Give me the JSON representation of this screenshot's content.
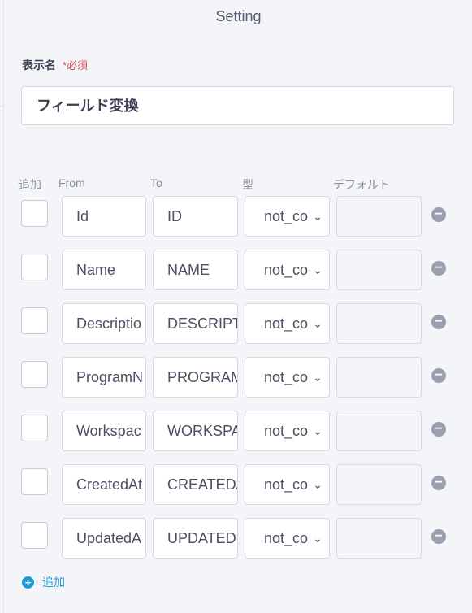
{
  "header": {
    "title": "Setting"
  },
  "display_name": {
    "label": "表示名",
    "required": "*必須",
    "value": "フィールド変換"
  },
  "table": {
    "headers": {
      "add": "追加",
      "from": "From",
      "to": "To",
      "type": "型",
      "default": "デフォルト"
    },
    "rows": [
      {
        "from": "Id",
        "to": "ID",
        "type": "not_co"
      },
      {
        "from": "Name",
        "to": "NAME",
        "type": "not_co"
      },
      {
        "from": "Descriptio",
        "to": "DESCRIPT",
        "type": "not_co"
      },
      {
        "from": "ProgramN",
        "to": "PROGRAM",
        "type": "not_co"
      },
      {
        "from": "Workspac",
        "to": "WORKSPA",
        "type": "not_co"
      },
      {
        "from": "CreatedAt",
        "to": "CREATEDA",
        "type": "not_co"
      },
      {
        "from": "UpdatedA",
        "to": "UPDATED",
        "type": "not_co"
      }
    ]
  },
  "add_button": {
    "label": "追加"
  }
}
